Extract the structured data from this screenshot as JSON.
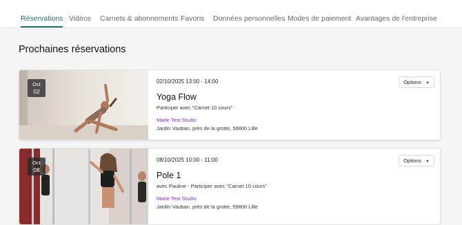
{
  "nav": {
    "tabs": [
      {
        "label": "Réservations",
        "active": true
      },
      {
        "label": "Vidéos"
      },
      {
        "label": "Carnets & abonnements"
      },
      {
        "label": "Favoris"
      },
      {
        "label": "Données personnelles"
      },
      {
        "label": "Modes de paiement"
      },
      {
        "label": "Avantages de l'entreprise"
      }
    ]
  },
  "main": {
    "title": "Prochaines réservations",
    "bookings": [
      {
        "month": "Oct",
        "day": "02",
        "datetime": "02/10/2025 13:00 - 14:00",
        "name": "Yoga Flow",
        "subtitle": "Participer avec \"Carnet 10 cours\"",
        "studio": "Marie Test Studio",
        "address": "Jardin Vauban, près de la grotte, 59800 Lille",
        "options_label": "Options"
      },
      {
        "month": "Oct",
        "day": "08",
        "datetime": "08/10/2025 10:00 - 11:00",
        "name": "Pole 1",
        "subtitle": "avec Pauline - Participer avec \"Carnet 10 cours\"",
        "studio": "Marie Test Studio",
        "address": "Jardin Vauban, près de la grotte, 59800 Lille",
        "options_label": "Options"
      }
    ]
  },
  "colors": {
    "accent": "#1f6f6a",
    "studio_link": "#7b2fc9"
  }
}
